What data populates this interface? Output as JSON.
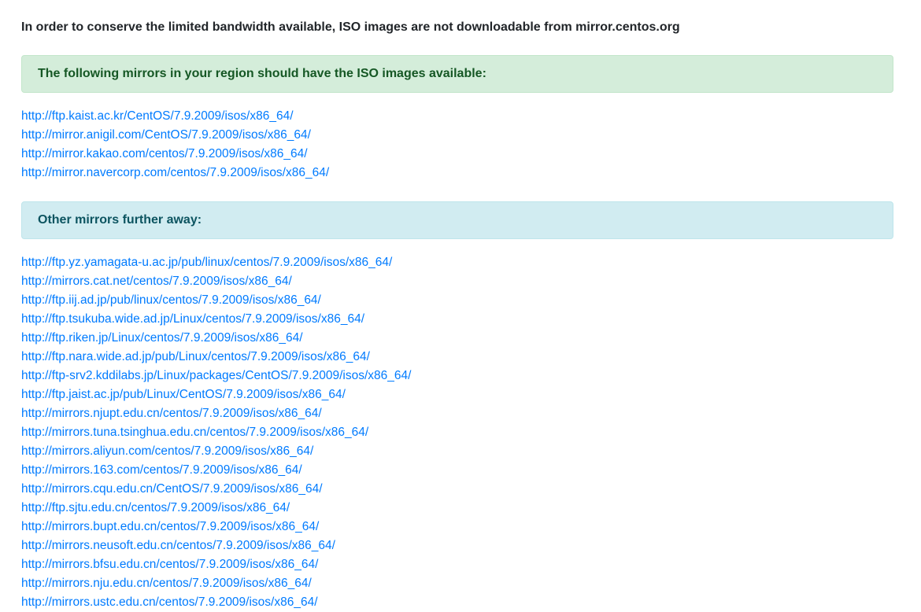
{
  "notice": "In order to conserve the limited bandwidth available, ISO images are not downloadable from mirror.centos.org",
  "region_alert": "The following mirrors in your region should have the ISO images available:",
  "region_mirrors": [
    "http://ftp.kaist.ac.kr/CentOS/7.9.2009/isos/x86_64/",
    "http://mirror.anigil.com/CentOS/7.9.2009/isos/x86_64/",
    "http://mirror.kakao.com/centos/7.9.2009/isos/x86_64/",
    "http://mirror.navercorp.com/centos/7.9.2009/isos/x86_64/"
  ],
  "other_alert": "Other mirrors further away:",
  "other_mirrors": [
    "http://ftp.yz.yamagata-u.ac.jp/pub/linux/centos/7.9.2009/isos/x86_64/",
    "http://mirrors.cat.net/centos/7.9.2009/isos/x86_64/",
    "http://ftp.iij.ad.jp/pub/linux/centos/7.9.2009/isos/x86_64/",
    "http://ftp.tsukuba.wide.ad.jp/Linux/centos/7.9.2009/isos/x86_64/",
    "http://ftp.riken.jp/Linux/centos/7.9.2009/isos/x86_64/",
    "http://ftp.nara.wide.ad.jp/pub/Linux/centos/7.9.2009/isos/x86_64/",
    "http://ftp-srv2.kddilabs.jp/Linux/packages/CentOS/7.9.2009/isos/x86_64/",
    "http://ftp.jaist.ac.jp/pub/Linux/CentOS/7.9.2009/isos/x86_64/",
    "http://mirrors.njupt.edu.cn/centos/7.9.2009/isos/x86_64/",
    "http://mirrors.tuna.tsinghua.edu.cn/centos/7.9.2009/isos/x86_64/",
    "http://mirrors.aliyun.com/centos/7.9.2009/isos/x86_64/",
    "http://mirrors.163.com/centos/7.9.2009/isos/x86_64/",
    "http://mirrors.cqu.edu.cn/CentOS/7.9.2009/isos/x86_64/",
    "http://ftp.sjtu.edu.cn/centos/7.9.2009/isos/x86_64/",
    "http://mirrors.bupt.edu.cn/centos/7.9.2009/isos/x86_64/",
    "http://mirrors.neusoft.edu.cn/centos/7.9.2009/isos/x86_64/",
    "http://mirrors.bfsu.edu.cn/centos/7.9.2009/isos/x86_64/",
    "http://mirrors.nju.edu.cn/centos/7.9.2009/isos/x86_64/",
    "http://mirrors.ustc.edu.cn/centos/7.9.2009/isos/x86_64/"
  ],
  "colors": {
    "link": "#007bff",
    "success_bg": "#d4edda",
    "success_text": "#155724",
    "info_bg": "#d1ecf1",
    "info_text": "#0c5460"
  }
}
